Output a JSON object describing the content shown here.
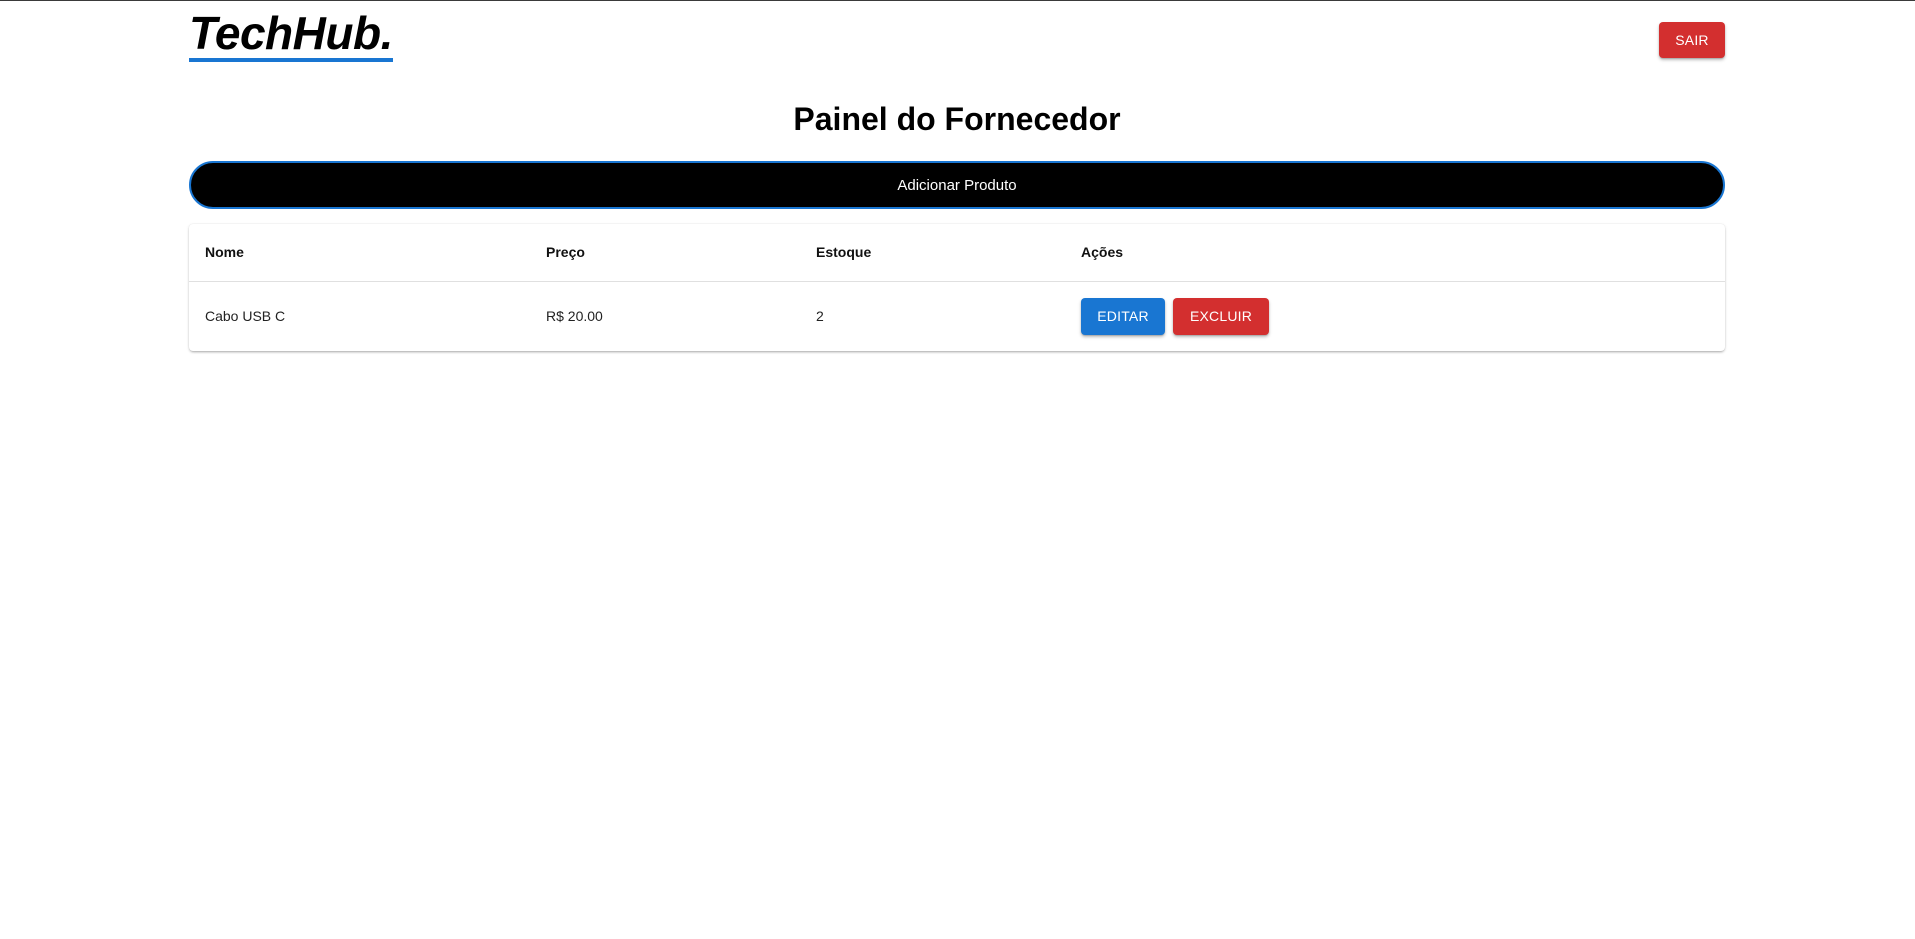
{
  "header": {
    "logo_text": "TechHub.",
    "logout_label": "SAIR"
  },
  "main": {
    "title": "Painel do Fornecedor",
    "add_product_label": "Adicionar Produto"
  },
  "table": {
    "columns": [
      "Nome",
      "Preço",
      "Estoque",
      "Ações"
    ],
    "rows": [
      {
        "name": "Cabo USB C",
        "price": "R$ 20.00",
        "stock": "2",
        "edit_label": "EDITAR",
        "delete_label": "EXCLUIR"
      }
    ]
  },
  "colors": {
    "primary": "#1976d2",
    "danger": "#d32f2f",
    "dark": "#000000"
  },
  "icons": []
}
